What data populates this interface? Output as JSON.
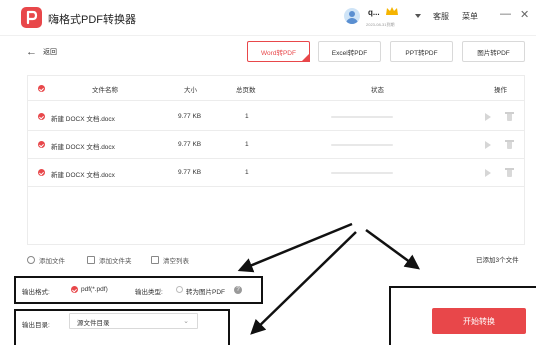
{
  "app": {
    "title": "嗨格式PDF转换器",
    "user_name": "q...",
    "user_expire": "2023-08-31到期",
    "service_label": "客服",
    "menu_label": "菜单",
    "minimize_glyph": "—",
    "close_glyph": "✕",
    "logo_icon": "pdf-logo-icon",
    "accent_color": "#e8474a"
  },
  "toolbar": {
    "back_label": "返回",
    "tabs": [
      {
        "label": "Word转PDF",
        "active": true
      },
      {
        "label": "Excel转PDF",
        "active": false
      },
      {
        "label": "PPT转PDF",
        "active": false
      },
      {
        "label": "图片转PDF",
        "active": false
      }
    ]
  },
  "table": {
    "headers": {
      "name": "文件名称",
      "size": "大小",
      "pages": "总页数",
      "status": "状态",
      "action": "操作"
    },
    "rows": [
      {
        "name": "新建 DOCX 文档.docx",
        "size": "9.77 KB",
        "pages": "1",
        "progress": 0
      },
      {
        "name": "新建 DOCX 文档.docx",
        "size": "9.77 KB",
        "pages": "1",
        "progress": 0
      },
      {
        "name": "新建 DOCX 文档.docx",
        "size": "9.77 KB",
        "pages": "1",
        "progress": 0
      }
    ]
  },
  "actions": {
    "add_file": "添加文件",
    "add_folder": "添加文件夹",
    "clear_list": "清空列表",
    "count_text": "已添加3个文件"
  },
  "output": {
    "format_label": "输出格式:",
    "format_value": "pdf(*.pdf)",
    "type_label": "输出类型:",
    "type_option": "转为图片PDF",
    "dir_label": "输出目录:",
    "dir_value": "源文件目录",
    "start_label": "开始转换",
    "help_glyph": "?"
  }
}
